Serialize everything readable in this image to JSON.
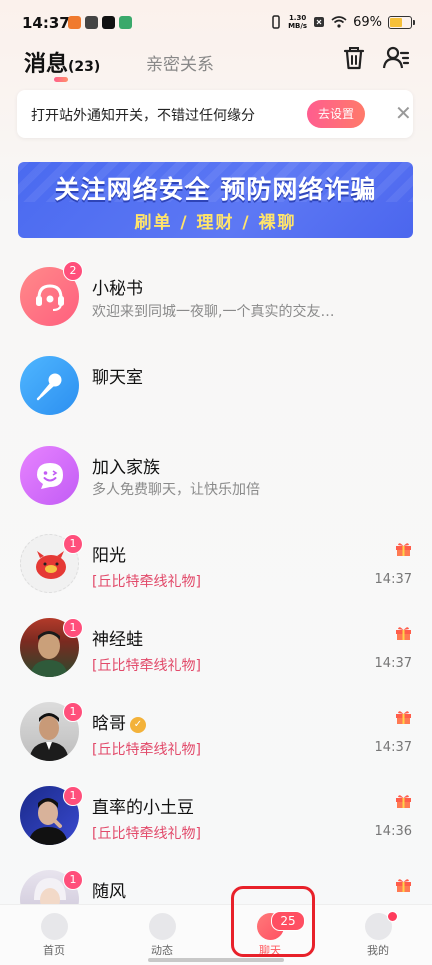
{
  "status_bar": {
    "time": "14:37",
    "net_speed_value": "1.30",
    "net_speed_unit": "MB/s",
    "battery": "69%",
    "battery_level": 0.69
  },
  "header": {
    "tab_messages": "消息",
    "tab_messages_count": "(23)",
    "tab_intimate": "亲密关系"
  },
  "notice": {
    "text": "打开站外通知开关，不错过任何缘分",
    "button": "去设置"
  },
  "banner": {
    "title": "关注网络安全 预防网络诈骗",
    "subtitle": "刷单 / 理财 / 裸聊"
  },
  "conversations": [
    {
      "name": "小秘书",
      "preview": "欢迎来到同城一夜聊,一个真实的交友…",
      "badge": "2"
    },
    {
      "name": "聊天室"
    },
    {
      "name": "加入家族",
      "preview": "多人免费聊天，让快乐加倍"
    },
    {
      "name": "阳光",
      "tag": "[丘比特牵线礼物]",
      "time": "14:37",
      "badge": "1"
    },
    {
      "name": "神经蛙",
      "tag": "[丘比特牵线礼物]",
      "time": "14:37",
      "badge": "1"
    },
    {
      "name": "晗哥",
      "tag": "[丘比特牵线礼物]",
      "time": "14:37",
      "badge": "1"
    },
    {
      "name": "直率的小土豆",
      "tag": "[丘比特牵线礼物]",
      "time": "14:36",
      "badge": "1"
    },
    {
      "name": "随风",
      "badge": "1"
    }
  ],
  "bottom_nav": [
    {
      "label": "首页"
    },
    {
      "label": "动态"
    },
    {
      "label": "聊天",
      "badge": "25"
    },
    {
      "label": "我的"
    }
  ],
  "colors": {
    "accent": "#ff5a5f",
    "gift_tag": "#e24a6a",
    "banner_blue": "#4a6af0",
    "highlight": "#e8212a"
  }
}
